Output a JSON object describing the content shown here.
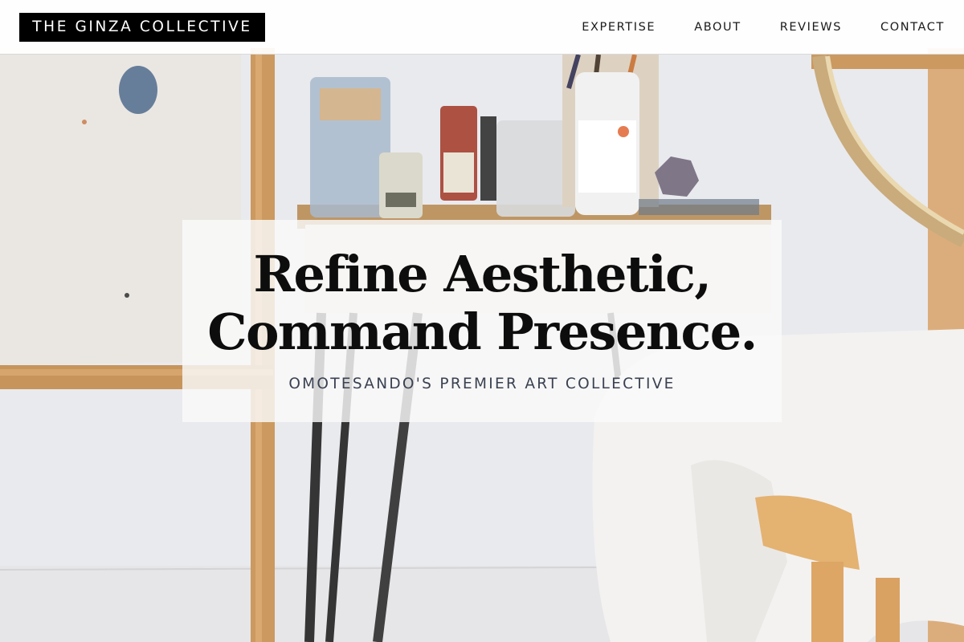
{
  "header": {
    "logo_text": "THE GINZA COLLECTIVE",
    "nav": [
      {
        "label": "EXPERTISE"
      },
      {
        "label": "ABOUT"
      },
      {
        "label": "REVIEWS"
      },
      {
        "label": "CONTACT"
      }
    ]
  },
  "hero": {
    "title_line1": "Refine Aesthetic,",
    "title_line2": "Command Presence.",
    "subtitle": "OMOTESANDO'S PREMIER ART COLLECTIVE"
  },
  "colors": {
    "logo_background": "#000000",
    "logo_text": "#ffffff",
    "title_text": "#0d0d0d",
    "subtitle_text": "#3a4150"
  }
}
